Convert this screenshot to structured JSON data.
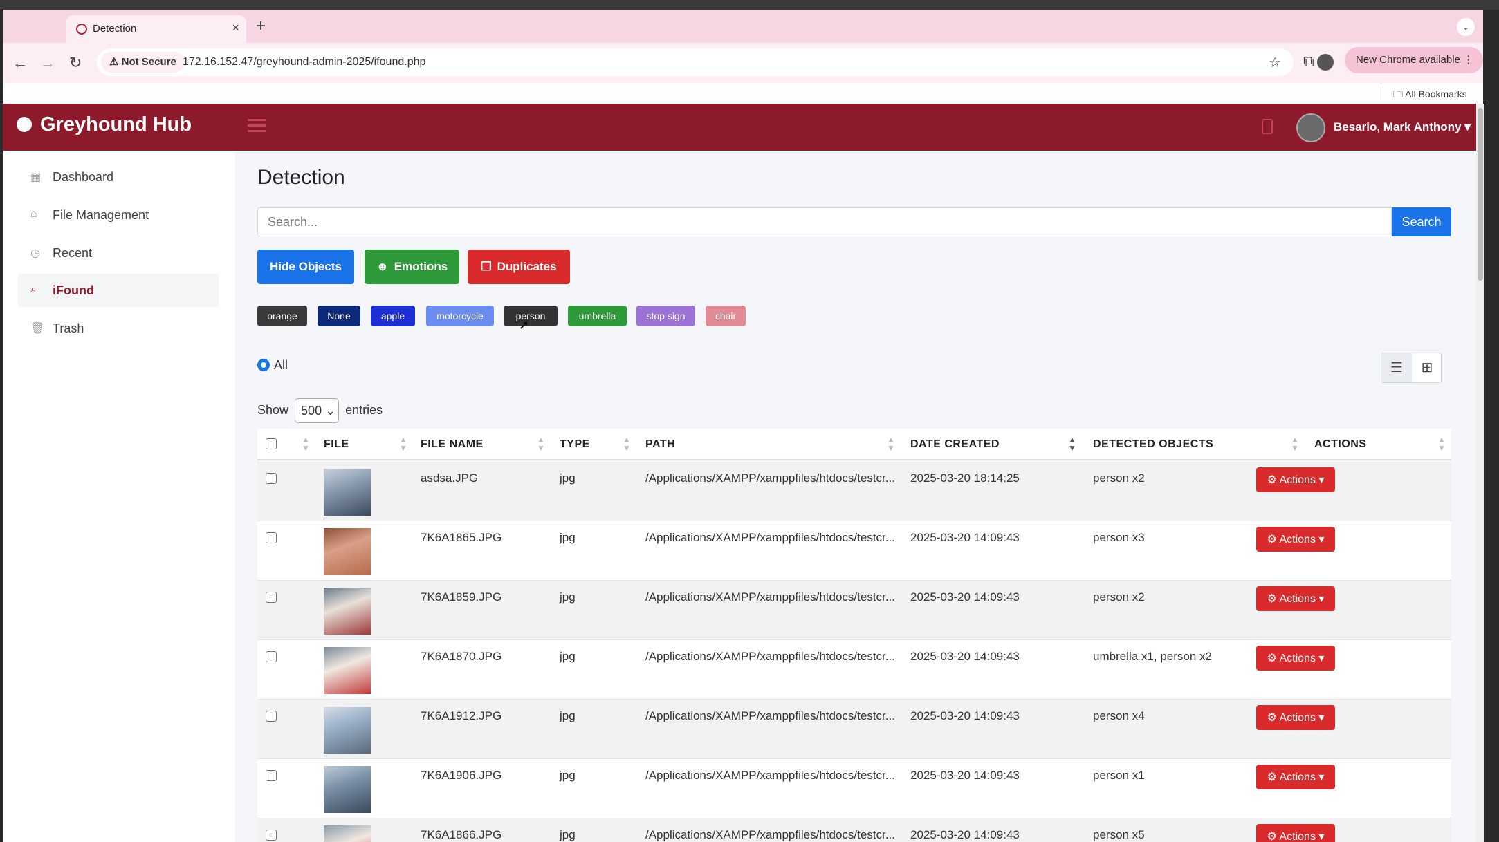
{
  "browser": {
    "tab_title": "Detection",
    "not_secure": "Not Secure",
    "url": "172.16.152.47/greyhound-admin-2025/ifound.php",
    "new_chrome": "New Chrome available",
    "all_bookmarks": "All Bookmarks"
  },
  "header": {
    "brand": "Greyhound Hub",
    "user": "Besario, Mark Anthony"
  },
  "sidebar": {
    "items": [
      {
        "label": "Dashboard",
        "icon": "grid-icon"
      },
      {
        "label": "File Management",
        "icon": "home-icon"
      },
      {
        "label": "Recent",
        "icon": "clock-icon"
      },
      {
        "label": "iFound",
        "icon": "search-icon"
      },
      {
        "label": "Trash",
        "icon": "trash-icon"
      }
    ]
  },
  "main": {
    "title": "Detection",
    "search_placeholder": "Search...",
    "search_button": "Search",
    "buttons": {
      "hide_objects": "Hide Objects",
      "emotions": "Emotions",
      "duplicates": "Duplicates"
    },
    "chips": [
      {
        "label": "orange",
        "color": "#3a3a3a"
      },
      {
        "label": "None",
        "color": "#0d2a7a"
      },
      {
        "label": "apple",
        "color": "#1f2fd8"
      },
      {
        "label": "motorcycle",
        "color": "#6b8cf0"
      },
      {
        "label": "person",
        "color": "#333333"
      },
      {
        "label": "umbrella",
        "color": "#2f9a3a"
      },
      {
        "label": "stop sign",
        "color": "#9b72d6"
      },
      {
        "label": "chair",
        "color": "#e08a96"
      }
    ],
    "radio_all": "All",
    "show_label": "Show",
    "entries_value": "500",
    "entries_label": "entries"
  },
  "table": {
    "headers": [
      "FILE",
      "FILE NAME",
      "TYPE",
      "PATH",
      "DATE CREATED",
      "DETECTED OBJECTS",
      "ACTIONS"
    ],
    "action_label": "Actions",
    "rows": [
      {
        "name": "asdsa.JPG",
        "type": "jpg",
        "path": "/Applications/XAMPP/xamppfiles/htdocs/testcr...",
        "date": "2025-03-20 18:14:25",
        "objects": "person x2"
      },
      {
        "name": "7K6A1865.JPG",
        "type": "jpg",
        "path": "/Applications/XAMPP/xamppfiles/htdocs/testcr...",
        "date": "2025-03-20 14:09:43",
        "objects": "person x3"
      },
      {
        "name": "7K6A1859.JPG",
        "type": "jpg",
        "path": "/Applications/XAMPP/xamppfiles/htdocs/testcr...",
        "date": "2025-03-20 14:09:43",
        "objects": "person x2"
      },
      {
        "name": "7K6A1870.JPG",
        "type": "jpg",
        "path": "/Applications/XAMPP/xamppfiles/htdocs/testcr...",
        "date": "2025-03-20 14:09:43",
        "objects": "umbrella x1, person x2"
      },
      {
        "name": "7K6A1912.JPG",
        "type": "jpg",
        "path": "/Applications/XAMPP/xamppfiles/htdocs/testcr...",
        "date": "2025-03-20 14:09:43",
        "objects": "person x4"
      },
      {
        "name": "7K6A1906.JPG",
        "type": "jpg",
        "path": "/Applications/XAMPP/xamppfiles/htdocs/testcr...",
        "date": "2025-03-20 14:09:43",
        "objects": "person x1"
      },
      {
        "name": "7K6A1866.JPG",
        "type": "jpg",
        "path": "/Applications/XAMPP/xamppfiles/htdocs/testcr...",
        "date": "2025-03-20 14:09:43",
        "objects": "person x5"
      }
    ]
  },
  "colors": {
    "brand": "#8c1a2b",
    "primary": "#1a73e8",
    "success": "#2f9a3a",
    "danger": "#d92b2b"
  }
}
